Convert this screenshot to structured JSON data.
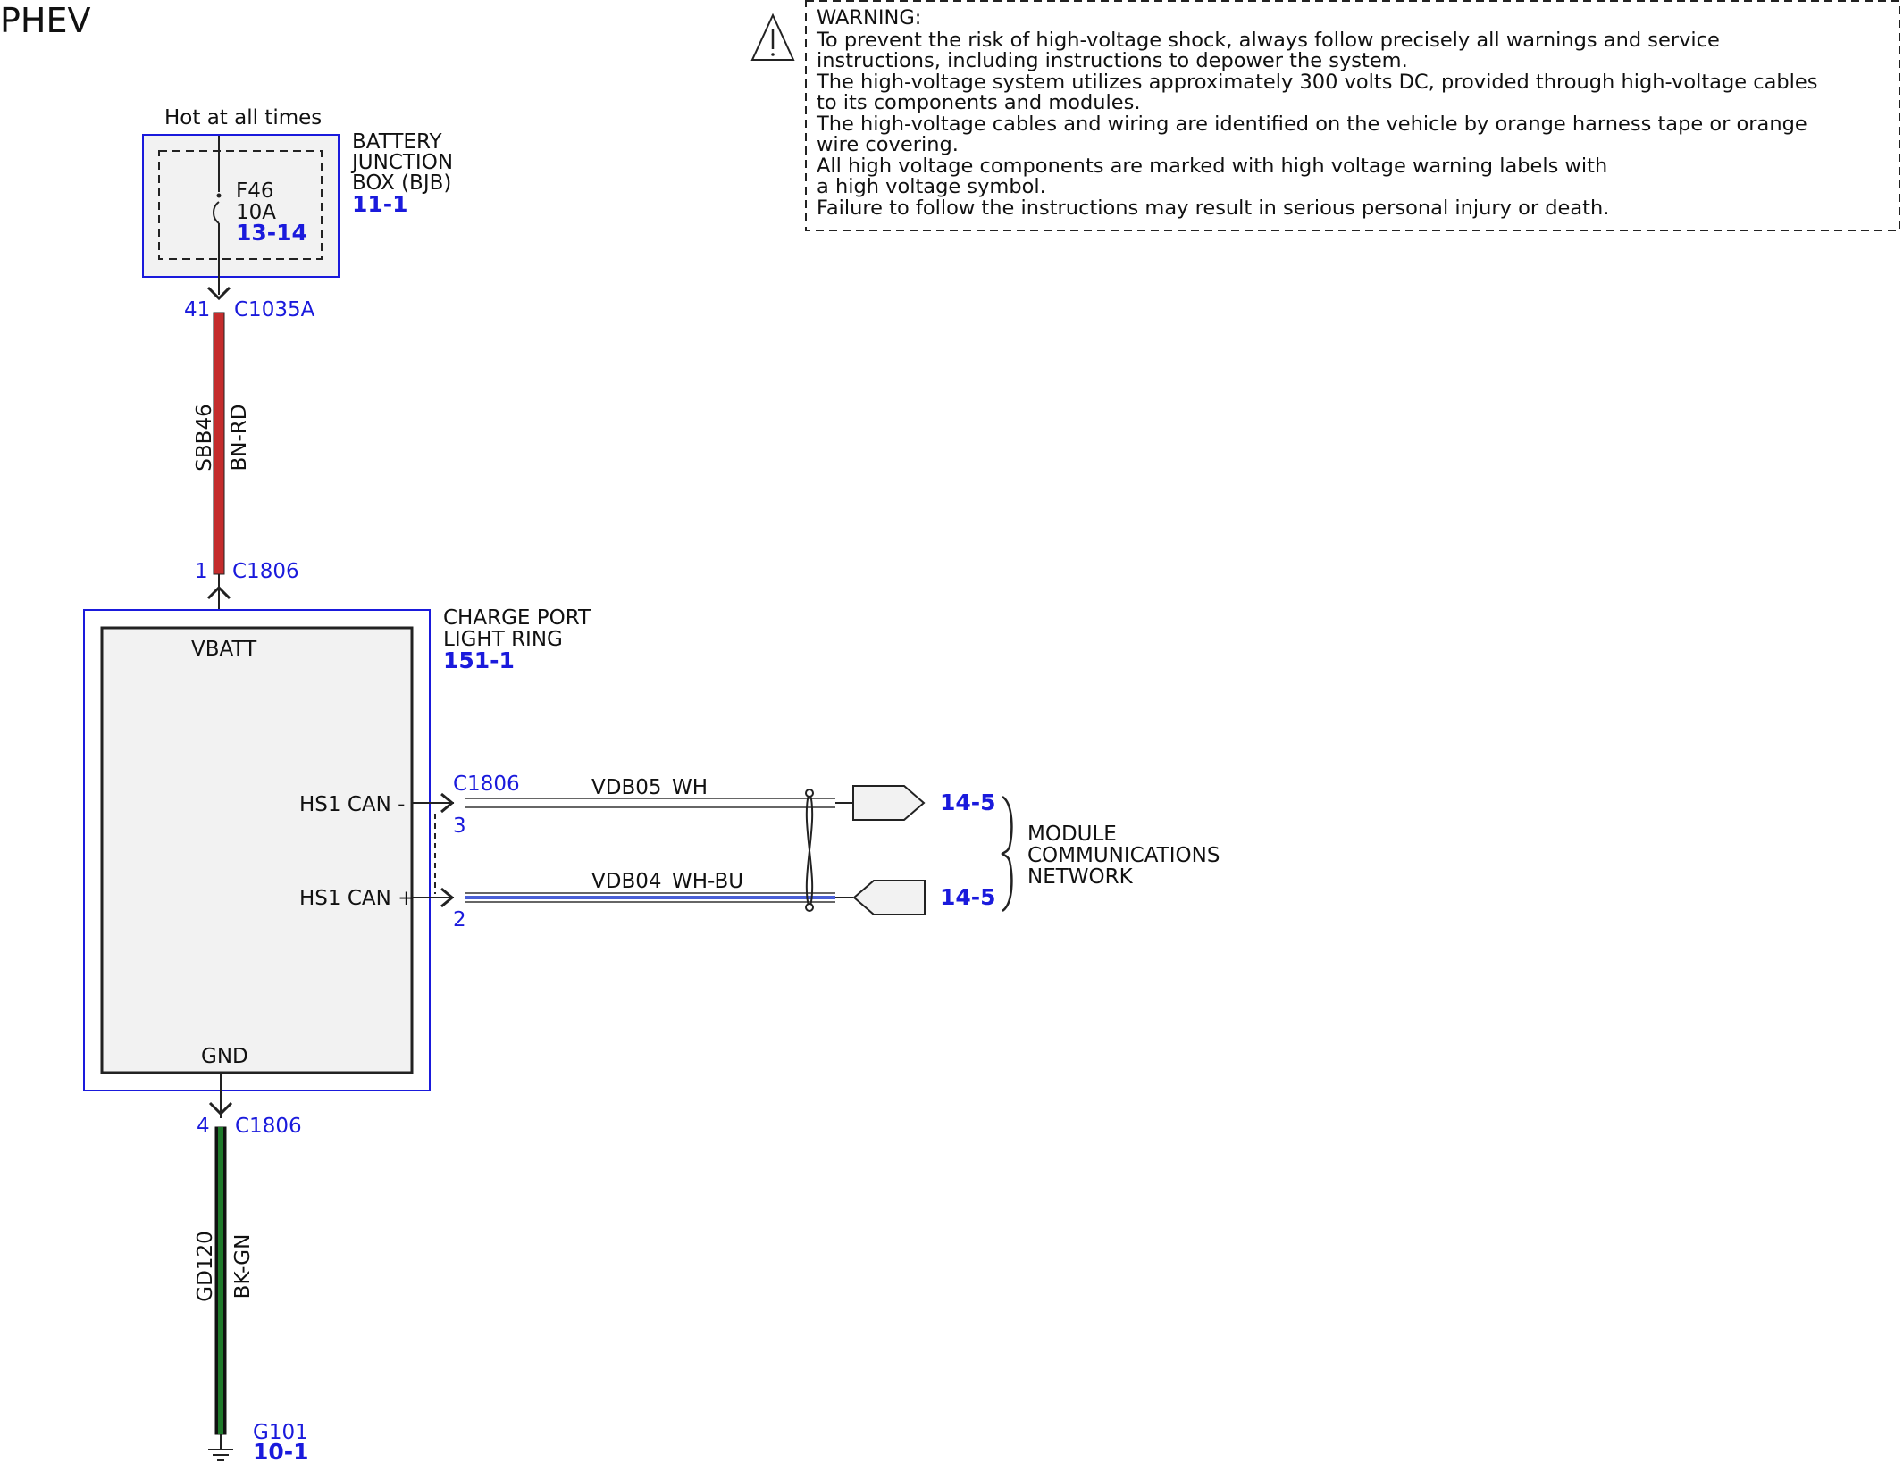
{
  "title": "PHEV",
  "warning": {
    "heading": "WARNING:",
    "lines": [
      "To prevent the risk of high-voltage shock, always follow precisely all warnings and service",
      "instructions, including instructions to depower the system.",
      "The high-voltage system utilizes approximately 300 volts DC, provided through high-voltage cables",
      "to its components and modules.",
      "The high-voltage cables and wiring are identified on the vehicle by orange harness tape or orange",
      "wire covering.",
      "All high voltage components are marked with high voltage warning labels with",
      "a high voltage symbol.",
      "Failure to follow the instructions may result in serious personal injury or death."
    ]
  },
  "bjb": {
    "supply_label": "Hot at all times",
    "name_lines": [
      "BATTERY",
      "JUNCTION",
      "BOX (BJB)"
    ],
    "ref": "11-1",
    "fuse_name": "F46",
    "fuse_rating": "10A",
    "fuse_ref": "13-14"
  },
  "power_wire": {
    "top_pin": "41",
    "top_connector": "C1035A",
    "circuit": "SBB46",
    "color_code": "BN-RD",
    "bottom_pin": "1",
    "bottom_connector": "C1806",
    "color": "#c42c2c"
  },
  "module": {
    "name_lines": [
      "CHARGE PORT",
      "LIGHT RING"
    ],
    "ref": "151-1",
    "pin_vbatt": "VBATT",
    "pin_can_minus": "HS1 CAN -",
    "pin_can_plus": "HS1 CAN +",
    "pin_gnd": "GND"
  },
  "can_bus": {
    "connector": "C1806",
    "minus": {
      "pin": "3",
      "circuit": "VDB05",
      "color_code": "WH",
      "ref": "14-5"
    },
    "plus": {
      "pin": "2",
      "circuit": "VDB04",
      "color_code": "WH-BU",
      "ref": "14-5"
    },
    "network_lines": [
      "MODULE",
      "COMMUNICATIONS",
      "NETWORK"
    ],
    "blue_stripe_color": "#4a5fd6"
  },
  "ground_wire": {
    "pin": "4",
    "connector": "C1806",
    "circuit": "GD120",
    "color_code": "BK-GN",
    "ground_name": "G101",
    "ground_ref": "10-1",
    "color": "#1f7a2a"
  },
  "colors": {
    "reference_blue": "#1a1adc",
    "component_fill": "#f2f2f2"
  }
}
